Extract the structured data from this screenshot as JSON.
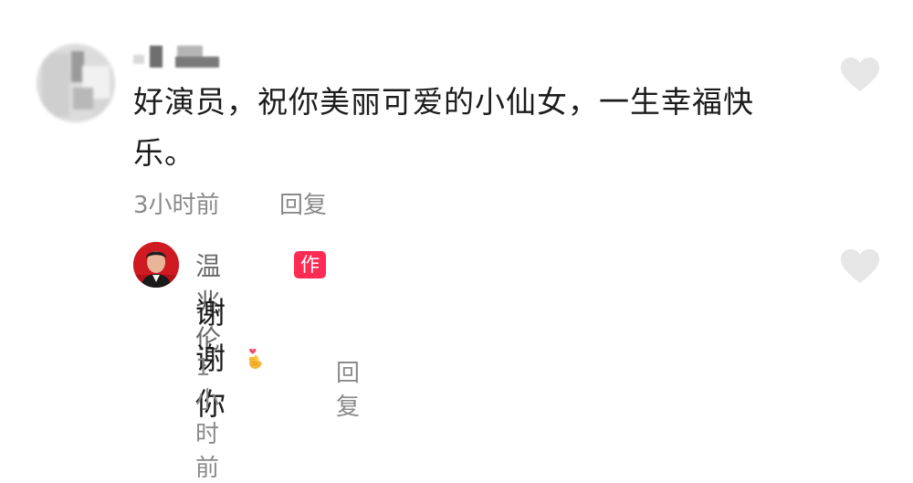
{
  "comment": {
    "author_name": "",
    "text": "好演员，祝你美丽可爱的小仙女，一生幸福快乐。",
    "time": "3小时前",
    "reply_label": "回复",
    "like_icon": "heart-icon"
  },
  "reply": {
    "author_name": "温兆伦",
    "author_badge": "作者",
    "text": "谢谢你",
    "emoji_icon": "finger-heart-emoji",
    "time": "1小时前",
    "reply_label": "回复",
    "like_icon": "heart-icon"
  },
  "colors": {
    "badge_bg": "#fe2c55",
    "meta_text": "#8a8a8a",
    "heart": "#e6e6e6"
  }
}
